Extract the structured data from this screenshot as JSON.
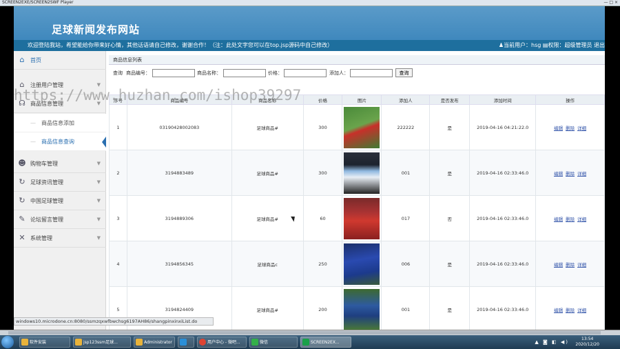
{
  "player": {
    "title": "SCREEN2EXE/SCREEN2SWF Player",
    "controls": "— □ ×"
  },
  "site": {
    "title": "足球新闻发布网站",
    "marquee": "欢迎登陆我站，希望能给你带来好心情，其他话语请自己修改，谢谢合作！（注：此处文字您可以在top.jsp源码中自己修改）",
    "user_text": "当前用户：hsg",
    "role_text": "权限：超级管理员",
    "logout": "退出"
  },
  "sidebar": {
    "items": [
      {
        "label": "首页",
        "icon": "home-icon",
        "glyph": "⌂"
      },
      {
        "label": "注册用户管理",
        "icon": "home-icon",
        "glyph": "⌂"
      },
      {
        "label": "商品信息管理",
        "icon": "users-icon",
        "glyph": "☊"
      },
      {
        "label": "购物车管理",
        "icon": "user-icon",
        "glyph": "☻"
      },
      {
        "label": "足球资讯管理",
        "icon": "refresh-icon",
        "glyph": "↻"
      },
      {
        "label": "中国足球管理",
        "icon": "refresh-icon",
        "glyph": "↻"
      },
      {
        "label": "论坛留言管理",
        "icon": "edit-icon",
        "glyph": "✎"
      },
      {
        "label": "系统管理",
        "icon": "tools-icon",
        "glyph": "✕"
      }
    ],
    "subitems": [
      {
        "label": "商品信息添加"
      },
      {
        "label": "商品信息查询"
      }
    ]
  },
  "main": {
    "panel_title": "商品信息列表",
    "search": {
      "query_label": "查询",
      "code_label": "商品编号：",
      "name_label": "商品名称：",
      "price_label": "价格：",
      "adder_label": "添加人：",
      "button": "查询"
    },
    "columns": [
      "序号",
      "商品编号",
      "商品名称",
      "价格",
      "图片",
      "添加人",
      "是否发布",
      "添加时间",
      "操作"
    ],
    "rows": [
      {
        "no": "1",
        "code": "03190428002083",
        "name": "足球商品#",
        "price": "300",
        "adder": "222222",
        "published": "是",
        "time": "2019-04-16 04:21:22.0"
      },
      {
        "no": "2",
        "code": "3194883489",
        "name": "足球商品#",
        "price": "300",
        "adder": "001",
        "published": "是",
        "time": "2019-04-16 02:33:46.0"
      },
      {
        "no": "3",
        "code": "3194889306",
        "name": "足球商品#",
        "price": "60",
        "adder": "017",
        "published": "否",
        "time": "2019-04-16 02:33:46.0"
      },
      {
        "no": "4",
        "code": "3194856345",
        "name": "足球商品c",
        "price": "250",
        "adder": "006",
        "published": "是",
        "time": "2019-04-16 02:33:46.0"
      },
      {
        "no": "5",
        "code": "3194824409",
        "name": "足球商品#",
        "price": "200",
        "adder": "001",
        "published": "是",
        "time": "2019-04-16 02:33:46.0"
      }
    ],
    "ops": {
      "edit": "编辑",
      "delete": "删除",
      "detail": "详细"
    }
  },
  "statusbar": {
    "text": "windows10.microdone.cn:8080/ssmzqxwfbwchsg6197AH86/shangpinxinxiList.do"
  },
  "watermark": {
    "text": "https://www.huzhan.com/ishop39297"
  },
  "taskbar": {
    "items": [
      {
        "label": "软件安装",
        "color": "#e8b33b"
      },
      {
        "label": "jsp123ssm足球...",
        "color": "#e8b33b"
      },
      {
        "label": "Administrator",
        "color": "#e8b33b"
      },
      {
        "label": "",
        "color": "#2a8fd8"
      },
      {
        "label": "用户中心 - 微吧...",
        "color": "#dd4433"
      },
      {
        "label": "微信",
        "color": "#34b04a"
      },
      {
        "label": "SCREEN2EX...",
        "color": "#1aa04a"
      }
    ],
    "time": "13:54",
    "date": "2020/12/20"
  },
  "colors": {
    "banner": "#4a90c4",
    "welcome_bar": "#1e6f9e",
    "accent": "#2a6fb0"
  }
}
